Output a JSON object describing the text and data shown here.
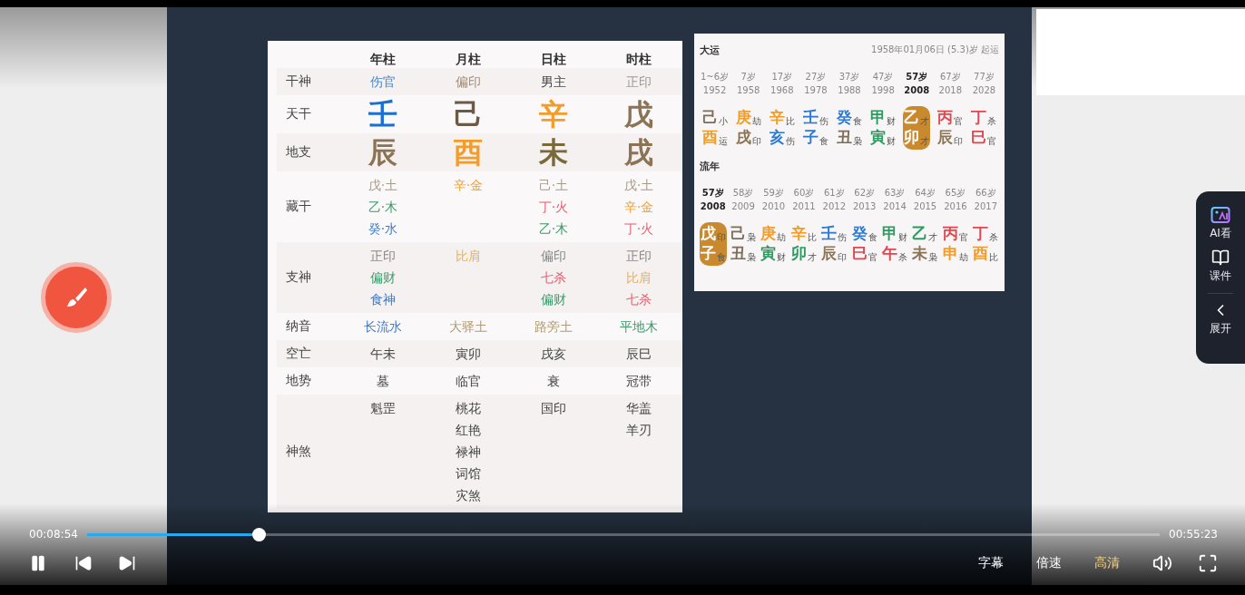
{
  "chart": {
    "columns": [
      "年柱",
      "月柱",
      "日柱",
      "时柱"
    ],
    "rows": [
      {
        "label": "干神",
        "kind": "small",
        "cells": [
          {
            "lines": [
              {
                "text": "伤官",
                "color": "#4a86c8"
              }
            ]
          },
          {
            "lines": [
              {
                "text": "偏印",
                "color": "#a08c78"
              }
            ]
          },
          {
            "lines": [
              {
                "text": "男主",
                "color": "#444444"
              }
            ]
          },
          {
            "lines": [
              {
                "text": "正印",
                "color": "#999999"
              }
            ]
          }
        ]
      },
      {
        "label": "天干",
        "kind": "big",
        "cells": [
          {
            "lines": [
              {
                "text": "壬",
                "color": "#1a6fd0"
              }
            ]
          },
          {
            "lines": [
              {
                "text": "己",
                "color": "#6b5a48"
              }
            ]
          },
          {
            "lines": [
              {
                "text": "辛",
                "color": "#f39c2a"
              }
            ]
          },
          {
            "lines": [
              {
                "text": "戊",
                "color": "#8b7355"
              }
            ]
          }
        ]
      },
      {
        "label": "地支",
        "kind": "big",
        "cells": [
          {
            "lines": [
              {
                "text": "辰",
                "color": "#8b7355"
              }
            ]
          },
          {
            "lines": [
              {
                "text": "酉",
                "color": "#f39c2a"
              }
            ]
          },
          {
            "lines": [
              {
                "text": "未",
                "color": "#7a6a3a"
              }
            ]
          },
          {
            "lines": [
              {
                "text": "戌",
                "color": "#8b7355"
              }
            ]
          }
        ]
      },
      {
        "label": "藏干",
        "kind": "small",
        "cells": [
          {
            "lines": [
              {
                "text": "戊·土",
                "color": "#a89a88"
              },
              {
                "text": "乙·木",
                "color": "#3a9a6a"
              },
              {
                "text": "癸·水",
                "color": "#3a78c8"
              }
            ]
          },
          {
            "lines": [
              {
                "text": "辛·金",
                "color": "#f0a030"
              }
            ]
          },
          {
            "lines": [
              {
                "text": "己·土",
                "color": "#a89a88"
              },
              {
                "text": "丁·火",
                "color": "#e06070"
              },
              {
                "text": "乙·木",
                "color": "#3a9a6a"
              }
            ]
          },
          {
            "lines": [
              {
                "text": "戊·土",
                "color": "#a89a88"
              },
              {
                "text": "辛·金",
                "color": "#f0a030"
              },
              {
                "text": "丁·火",
                "color": "#e06070"
              }
            ]
          }
        ]
      },
      {
        "label": "支神",
        "kind": "small",
        "cells": [
          {
            "lines": [
              {
                "text": "正印",
                "color": "#888888"
              },
              {
                "text": "偏财",
                "color": "#3a9a6a"
              },
              {
                "text": "食神",
                "color": "#3a78c8"
              }
            ]
          },
          {
            "lines": [
              {
                "text": "比肩",
                "color": "#f0b040"
              }
            ]
          },
          {
            "lines": [
              {
                "text": "偏印",
                "color": "#888888"
              },
              {
                "text": "七杀",
                "color": "#e06070"
              },
              {
                "text": "偏财",
                "color": "#3a9a6a"
              }
            ]
          },
          {
            "lines": [
              {
                "text": "正印",
                "color": "#888888"
              },
              {
                "text": "比肩",
                "color": "#f0b040"
              },
              {
                "text": "七杀",
                "color": "#e06070"
              }
            ]
          }
        ]
      },
      {
        "label": "纳音",
        "kind": "small",
        "cells": [
          {
            "lines": [
              {
                "text": "长流水",
                "color": "#3a78c8"
              }
            ]
          },
          {
            "lines": [
              {
                "text": "大驿土",
                "color": "#b09a70"
              }
            ]
          },
          {
            "lines": [
              {
                "text": "路旁土",
                "color": "#b09a70"
              }
            ]
          },
          {
            "lines": [
              {
                "text": "平地木",
                "color": "#3a9a6a"
              }
            ]
          }
        ]
      },
      {
        "label": "空亡",
        "kind": "small",
        "cells": [
          {
            "lines": [
              {
                "text": "午未"
              }
            ]
          },
          {
            "lines": [
              {
                "text": "寅卯"
              }
            ]
          },
          {
            "lines": [
              {
                "text": "戌亥"
              }
            ]
          },
          {
            "lines": [
              {
                "text": "辰巳"
              }
            ]
          }
        ]
      },
      {
        "label": "地势",
        "kind": "small",
        "cells": [
          {
            "lines": [
              {
                "text": "墓"
              }
            ]
          },
          {
            "lines": [
              {
                "text": "临官"
              }
            ]
          },
          {
            "lines": [
              {
                "text": "衰"
              }
            ]
          },
          {
            "lines": [
              {
                "text": "冠带"
              }
            ]
          }
        ]
      },
      {
        "label": "神煞",
        "kind": "small",
        "cells": [
          {
            "lines": [
              {
                "text": "魁罡"
              }
            ]
          },
          {
            "lines": [
              {
                "text": "桃花"
              },
              {
                "text": "红艳"
              },
              {
                "text": "禄神"
              },
              {
                "text": "词馆"
              },
              {
                "text": "灾煞"
              }
            ]
          },
          {
            "lines": [
              {
                "text": "国印"
              }
            ]
          },
          {
            "lines": [
              {
                "text": "华盖"
              },
              {
                "text": "羊刃"
              }
            ]
          }
        ]
      }
    ]
  },
  "dayun": {
    "title": "大运",
    "start": "1958年01月06日 (5.3)岁 起运",
    "periods": [
      {
        "age": "1~6岁",
        "year": "1952",
        "stem": {
          "text": "己",
          "color": "#7d6e5a"
        },
        "stem_god": "小",
        "branch": {
          "text": "酉",
          "color": "#f39c2a"
        },
        "branch_god": "运",
        "selected": false
      },
      {
        "age": "7岁",
        "year": "1958",
        "stem": {
          "text": "庚",
          "color": "#f39c2a"
        },
        "stem_god": "劫",
        "branch": {
          "text": "戌",
          "color": "#8b7355"
        },
        "branch_god": "印",
        "selected": false
      },
      {
        "age": "17岁",
        "year": "1968",
        "stem": {
          "text": "辛",
          "color": "#f39c2a"
        },
        "stem_god": "比",
        "branch": {
          "text": "亥",
          "color": "#2d78d2"
        },
        "branch_god": "伤",
        "selected": false
      },
      {
        "age": "27岁",
        "year": "1978",
        "stem": {
          "text": "壬",
          "color": "#2d78d2"
        },
        "stem_god": "伤",
        "branch": {
          "text": "子",
          "color": "#2d78d2"
        },
        "branch_god": "食",
        "selected": false
      },
      {
        "age": "37岁",
        "year": "1988",
        "stem": {
          "text": "癸",
          "color": "#2d78d2"
        },
        "stem_god": "食",
        "branch": {
          "text": "丑",
          "color": "#7d6e5a"
        },
        "branch_god": "枭",
        "selected": false
      },
      {
        "age": "47岁",
        "year": "1998",
        "stem": {
          "text": "甲",
          "color": "#2e9a60"
        },
        "stem_god": "财",
        "branch": {
          "text": "寅",
          "color": "#2e9a60"
        },
        "branch_god": "财",
        "selected": false
      },
      {
        "age": "57岁",
        "year": "2008",
        "stem": {
          "text": "乙"
        },
        "stem_god": "才",
        "branch": {
          "text": "卯"
        },
        "branch_god": "才",
        "selected": true
      },
      {
        "age": "67岁",
        "year": "2018",
        "stem": {
          "text": "丙",
          "color": "#e2464f"
        },
        "stem_god": "官",
        "branch": {
          "text": "辰",
          "color": "#8b7355"
        },
        "branch_god": "印",
        "selected": false
      },
      {
        "age": "77岁",
        "year": "2028",
        "stem": {
          "text": "丁",
          "color": "#e2464f"
        },
        "stem_god": "杀",
        "branch": {
          "text": "巳",
          "color": "#e2464f"
        },
        "branch_god": "官",
        "selected": false
      }
    ]
  },
  "liunian": {
    "title": "流年",
    "years": [
      {
        "age": "57岁",
        "year": "2008",
        "stem": {
          "text": "戊"
        },
        "stem_god": "印",
        "branch": {
          "text": "子"
        },
        "branch_god": "食",
        "selected": true
      },
      {
        "age": "58岁",
        "year": "2009",
        "stem": {
          "text": "己",
          "color": "#7d6e5a"
        },
        "stem_god": "枭",
        "branch": {
          "text": "丑",
          "color": "#7d6e5a"
        },
        "branch_god": "枭",
        "selected": false
      },
      {
        "age": "59岁",
        "year": "2010",
        "stem": {
          "text": "庚",
          "color": "#f39c2a"
        },
        "stem_god": "劫",
        "branch": {
          "text": "寅",
          "color": "#2e9a60"
        },
        "branch_god": "财",
        "selected": false
      },
      {
        "age": "60岁",
        "year": "2011",
        "stem": {
          "text": "辛",
          "color": "#f39c2a"
        },
        "stem_god": "比",
        "branch": {
          "text": "卯",
          "color": "#2e9a60"
        },
        "branch_god": "才",
        "selected": false
      },
      {
        "age": "61岁",
        "year": "2012",
        "stem": {
          "text": "壬",
          "color": "#2d78d2"
        },
        "stem_god": "伤",
        "branch": {
          "text": "辰",
          "color": "#8b7355"
        },
        "branch_god": "印",
        "selected": false
      },
      {
        "age": "62岁",
        "year": "2013",
        "stem": {
          "text": "癸",
          "color": "#2d78d2"
        },
        "stem_god": "食",
        "branch": {
          "text": "巳",
          "color": "#e2464f"
        },
        "branch_god": "官",
        "selected": false
      },
      {
        "age": "63岁",
        "year": "2014",
        "stem": {
          "text": "甲",
          "color": "#2e9a60"
        },
        "stem_god": "财",
        "branch": {
          "text": "午",
          "color": "#e2464f"
        },
        "branch_god": "杀",
        "selected": false
      },
      {
        "age": "64岁",
        "year": "2015",
        "stem": {
          "text": "乙",
          "color": "#2e9a60"
        },
        "stem_god": "才",
        "branch": {
          "text": "未",
          "color": "#8b7355"
        },
        "branch_god": "枭",
        "selected": false
      },
      {
        "age": "65岁",
        "year": "2016",
        "stem": {
          "text": "丙",
          "color": "#e2464f"
        },
        "stem_god": "官",
        "branch": {
          "text": "申",
          "color": "#f39c2a"
        },
        "branch_god": "劫",
        "selected": false
      },
      {
        "age": "66岁",
        "year": "2017",
        "stem": {
          "text": "丁",
          "color": "#e2464f"
        },
        "stem_god": "杀",
        "branch": {
          "text": "酉",
          "color": "#f39c2a"
        },
        "branch_god": "比",
        "selected": false
      }
    ]
  },
  "side_panel": {
    "items": [
      {
        "kind": "ai",
        "label": "AI看"
      },
      {
        "kind": "courseware",
        "label": "课件"
      },
      {
        "kind": "expand",
        "label": "展开"
      }
    ]
  },
  "player": {
    "playing": true,
    "current_time": "00:08:54",
    "total_time": "00:55:23",
    "level": 0.16,
    "options": [
      {
        "label": "字幕",
        "selected": false
      },
      {
        "label": "倍速",
        "selected": false
      },
      {
        "label": "高清",
        "selected": true
      }
    ]
  }
}
